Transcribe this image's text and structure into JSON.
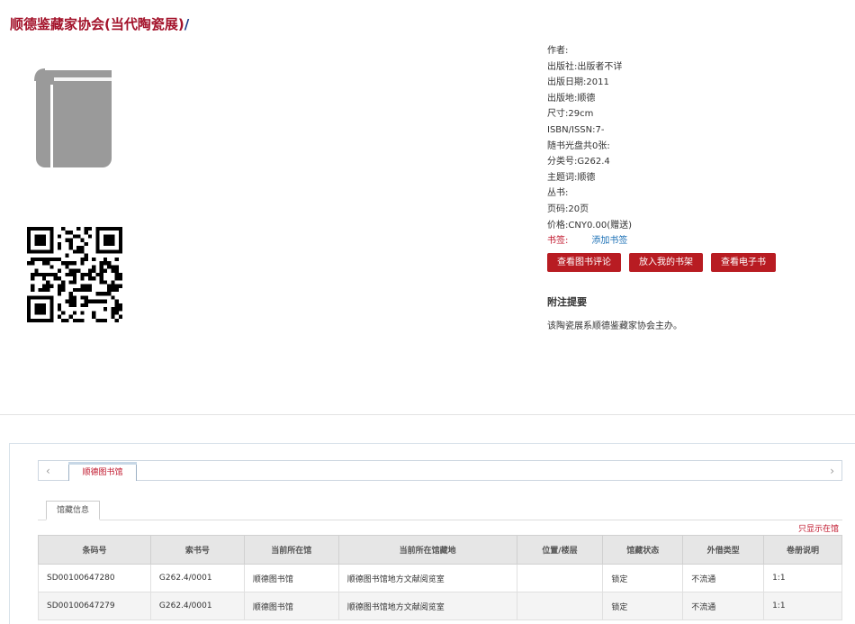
{
  "title": {
    "main": "顺德鉴藏家协会(当代陶瓷展)",
    "slash": "/"
  },
  "icons": {
    "cover": "book-icon",
    "qr": "qr-code-icon"
  },
  "meta": {
    "rows": [
      "作者:",
      "出版社:出版者不详",
      "出版日期:2011",
      "出版地:顺德",
      "尺寸:29cm",
      "ISBN/ISSN:7-",
      "随书光盘共0张:",
      "分类号:G262.4",
      "主题词:顺德",
      "丛书:",
      "页码:20页",
      "价格:CNY0.00(赠送)"
    ],
    "tag_label": "书签:",
    "tag_link": "添加书签"
  },
  "buttons": {
    "review": "查看图书评论",
    "shelf": "放入我的书架",
    "ebook": "查看电子书"
  },
  "notes": {
    "title": "附注提要",
    "text": "该陶瓷展系顺德鉴藏家协会主办。"
  },
  "holdings": {
    "nav_prev": "‹",
    "nav_next": "›",
    "library_tab": "顺德图书馆",
    "sub_tab": "馆藏信息",
    "only_shelf": "只显示在馆",
    "columns": [
      "条码号",
      "索书号",
      "当前所在馆",
      "当前所在馆藏地",
      "位置/楼层",
      "馆藏状态",
      "外借类型",
      "卷册说明"
    ],
    "rows": [
      [
        "SD00100647280",
        "G262.4/0001",
        "顺德图书馆",
        "顺德图书馆地方文献阅览室",
        "",
        "锁定",
        "不流通",
        "1:1"
      ],
      [
        "SD00100647279",
        "G262.4/0001",
        "顺德图书馆",
        "顺德图书馆地方文献阅览室",
        "",
        "锁定",
        "不流通",
        "1:1"
      ]
    ]
  },
  "colors": {
    "accent": "#b81c22",
    "title": "#a3122a",
    "link": "#1a6fb5"
  }
}
